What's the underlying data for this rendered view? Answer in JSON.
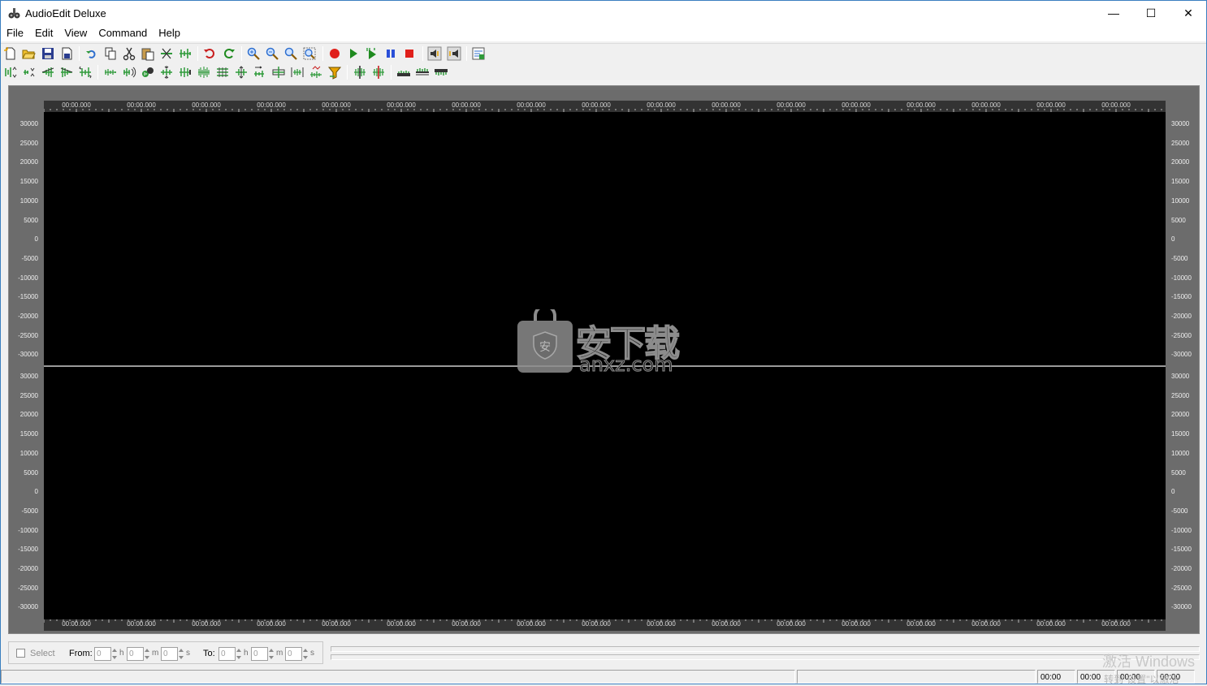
{
  "window": {
    "title": "AudioEdit Deluxe",
    "minimize": "—",
    "maximize": "☐",
    "close": "✕"
  },
  "menu": [
    "File",
    "Edit",
    "View",
    "Command",
    "Help"
  ],
  "ruler": {
    "label": "00:00.000",
    "count": 17
  },
  "axis": {
    "labels": [
      "30000",
      "25000",
      "20000",
      "15000",
      "10000",
      "5000",
      "0",
      "-5000",
      "-10000",
      "-15000",
      "-20000",
      "-25000",
      "-30000"
    ]
  },
  "watermark": {
    "text": "安下载",
    "subtext": "anxz.com",
    "shield": "安"
  },
  "controls": {
    "select_label": "Select",
    "from_label": "From:",
    "to_label": "To:",
    "from_h": "0",
    "from_m": "0",
    "from_s": "0",
    "to_h": "0",
    "to_m": "0",
    "to_s": "0",
    "unit_h": "h",
    "unit_m": "m",
    "unit_s": "s"
  },
  "status": {
    "t1": "00:00",
    "t2": "00:00",
    "t3": "00:00",
    "t4": "00:00",
    "activation": "激活 Windows",
    "activation_sub": "转到\"设置\"以激活"
  },
  "colors": {
    "waveform_bg": "#000000",
    "panel": "#6c6c6c",
    "record": "#e0201b",
    "play": "#1f8a1f",
    "pause": "#2a4fd8",
    "icon_green": "#2f9a3a"
  }
}
